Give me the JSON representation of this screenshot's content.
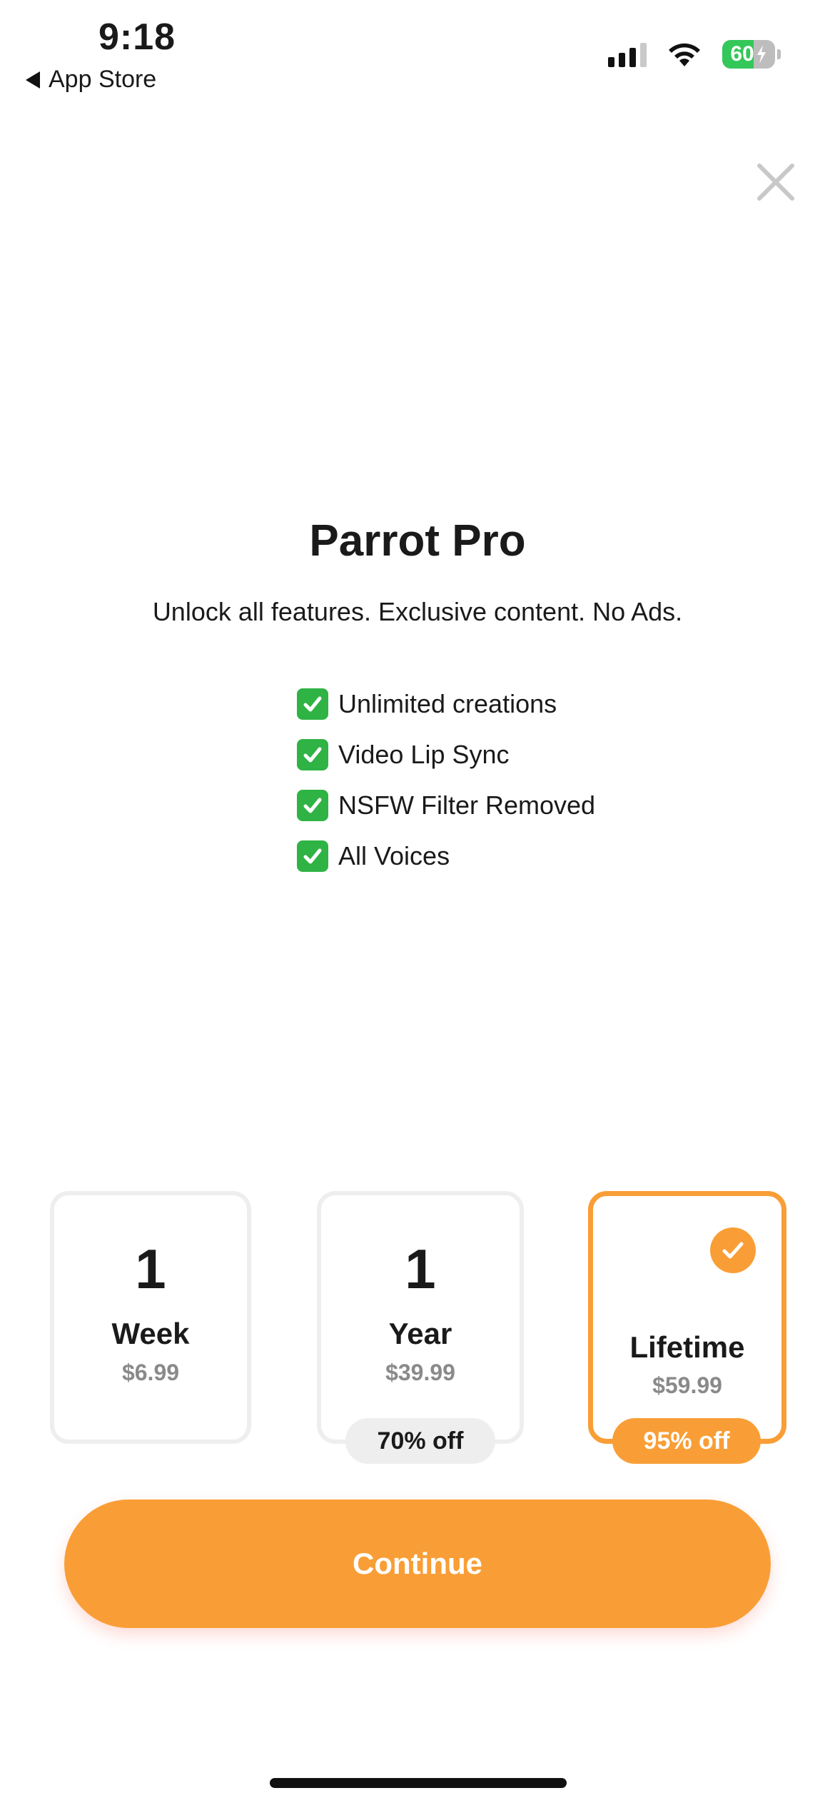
{
  "status_bar": {
    "time": "9:18",
    "back_label": "App Store",
    "battery_level": "60",
    "battery_percent": 60
  },
  "paywall": {
    "title": "Parrot Pro",
    "subtitle": "Unlock all features. Exclusive content. No Ads.",
    "features": [
      {
        "label": "Unlimited creations"
      },
      {
        "label": "Video Lip Sync"
      },
      {
        "label": "NSFW Filter Removed"
      },
      {
        "label": "All Voices"
      }
    ]
  },
  "plans": [
    {
      "number": "1",
      "name": "Week",
      "price": "$6.99",
      "badge": "",
      "selected": false
    },
    {
      "number": "1",
      "name": "Year",
      "price": "$39.99",
      "badge": "70% off",
      "selected": false
    },
    {
      "number": "",
      "name": "Lifetime",
      "price": "$59.99",
      "badge": "95% off",
      "selected": true
    }
  ],
  "actions": {
    "continue_label": "Continue"
  },
  "colors": {
    "accent": "#f99e36",
    "check_green": "#2fb344",
    "muted_text": "#8a8a8a"
  }
}
